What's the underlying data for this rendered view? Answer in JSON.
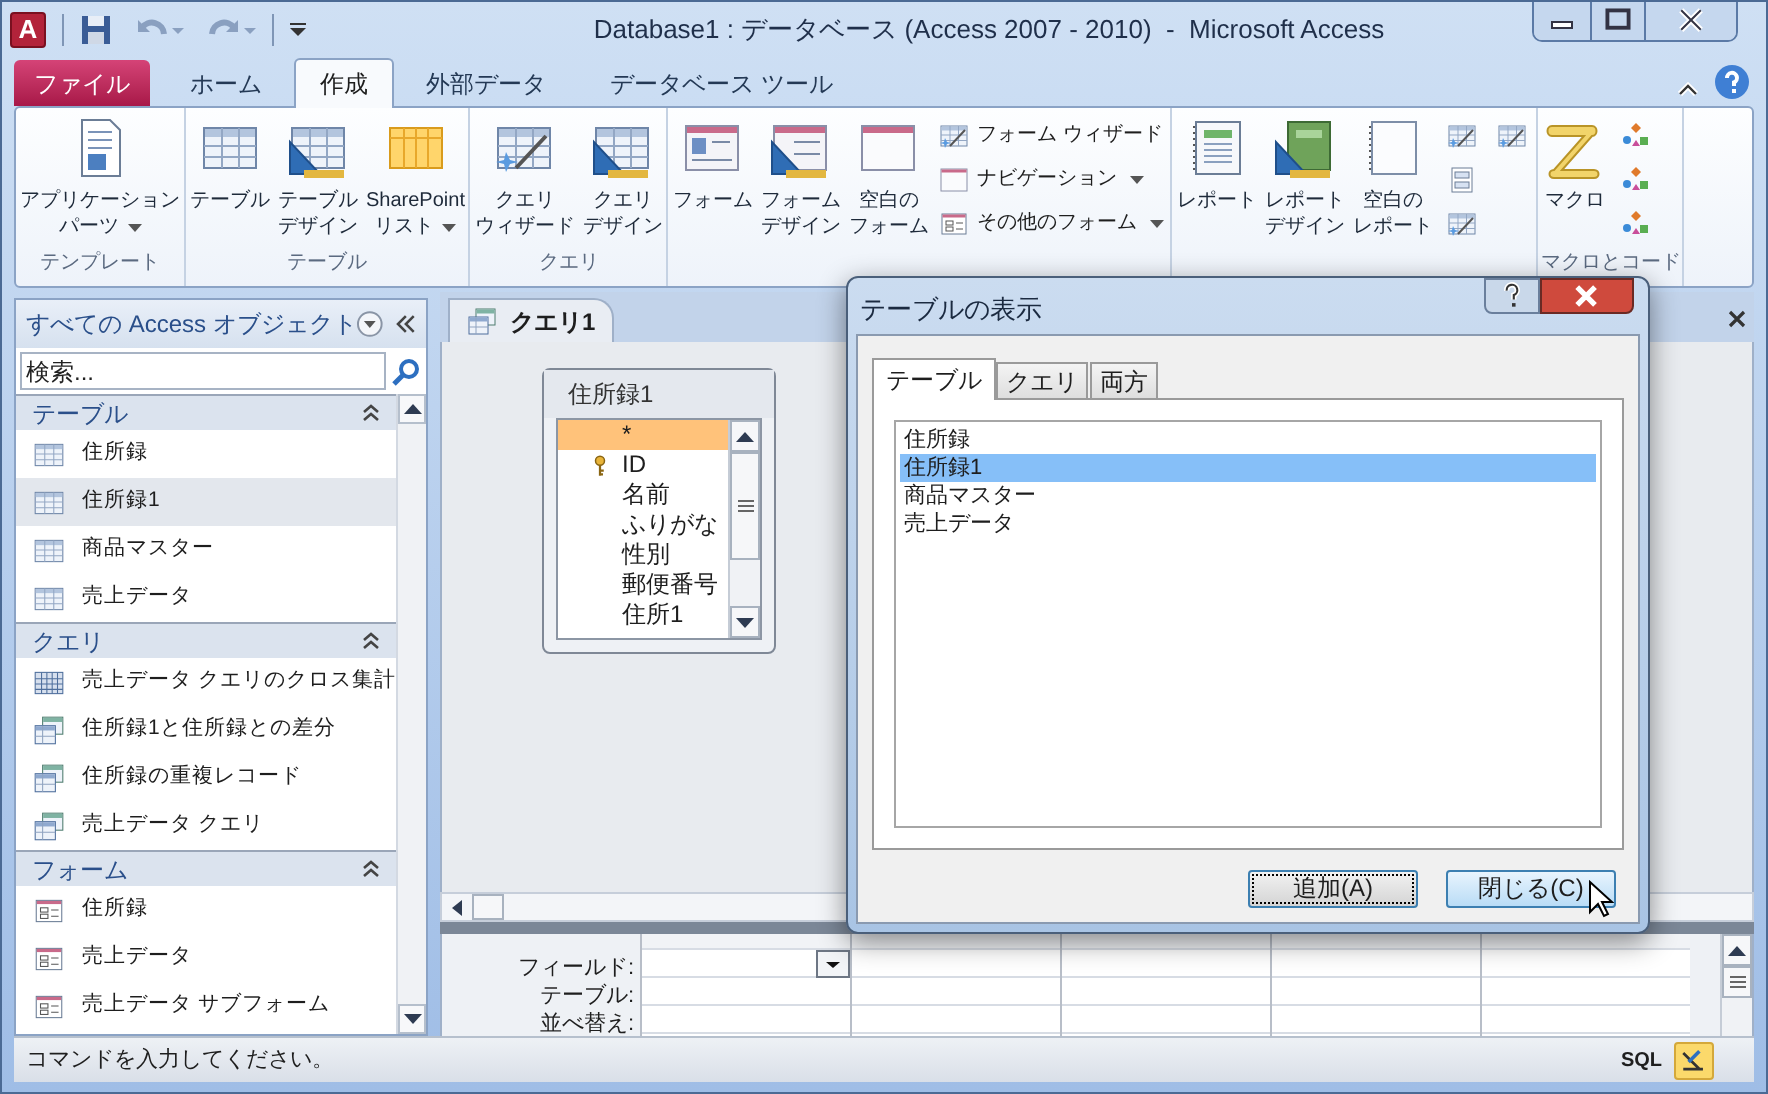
{
  "title_bar": {
    "logo_letter": "A",
    "title": "Database1 : データベース (Access 2007 - 2010)  -  Microsoft Access"
  },
  "ribbon": {
    "tabs": [
      {
        "label": "ファイル",
        "kind": "file",
        "selected": false
      },
      {
        "label": "ホーム",
        "kind": "tab",
        "selected": false
      },
      {
        "label": "作成",
        "kind": "tab",
        "selected": true
      },
      {
        "label": "外部データ",
        "kind": "tab",
        "selected": false
      },
      {
        "label": "データベース ツール",
        "kind": "tab",
        "selected": false
      }
    ],
    "groups": [
      {
        "label": "テンプレート",
        "items": [
          {
            "kind": "large",
            "lines": [
              "アプリケーション",
              "パーツ"
            ],
            "dropdown": true
          }
        ]
      },
      {
        "label": "テーブル",
        "items": [
          {
            "kind": "large",
            "lines": [
              "テーブル"
            ],
            "dropdown": false
          },
          {
            "kind": "large",
            "lines": [
              "テーブル",
              "デザイン"
            ],
            "dropdown": false
          },
          {
            "kind": "large",
            "lines": [
              "SharePoint",
              "リスト"
            ],
            "dropdown": true
          }
        ]
      },
      {
        "label": "クエリ",
        "items": [
          {
            "kind": "large",
            "lines": [
              "クエリ",
              "ウィザード"
            ],
            "dropdown": false
          },
          {
            "kind": "large",
            "lines": [
              "クエリ",
              "デザイン"
            ],
            "dropdown": false
          }
        ]
      },
      {
        "items": [
          {
            "kind": "large",
            "lines": [
              "フォーム"
            ],
            "dropdown": false
          },
          {
            "kind": "large",
            "lines": [
              "フォーム",
              "デザイン"
            ],
            "dropdown": false
          },
          {
            "kind": "large",
            "lines": [
              "空白の",
              "フォーム"
            ],
            "dropdown": false
          },
          {
            "kind": "small",
            "label": "フォーム ウィザード",
            "dropdown": false
          },
          {
            "kind": "small",
            "label": "ナビゲーション",
            "dropdown": true
          },
          {
            "kind": "small",
            "label": "その他のフォーム",
            "dropdown": true
          }
        ]
      },
      {
        "items": [
          {
            "kind": "large",
            "lines": [
              "レポート"
            ],
            "dropdown": false
          },
          {
            "kind": "large",
            "lines": [
              "レポート",
              "デザイン"
            ],
            "dropdown": false
          },
          {
            "kind": "large",
            "lines": [
              "空白の",
              "レポート"
            ],
            "dropdown": false
          },
          {
            "kind": "icon"
          },
          {
            "kind": "icon"
          },
          {
            "kind": "icon"
          },
          {
            "kind": "icon"
          }
        ]
      },
      {
        "label": "マクロとコード",
        "items": [
          {
            "kind": "large",
            "lines": [
              "マクロ"
            ],
            "dropdown": false
          },
          {
            "kind": "icon"
          },
          {
            "kind": "icon"
          },
          {
            "kind": "icon"
          }
        ]
      }
    ]
  },
  "nav_pane": {
    "title": "すべての Access オブジェクト",
    "search": {
      "placeholder": "検索..."
    },
    "sections": [
      {
        "label": "テーブル",
        "expanded": true,
        "kind": "table",
        "items": [
          {
            "label": "住所録",
            "selected": false
          },
          {
            "label": "住所録1",
            "selected": true
          },
          {
            "label": "商品マスター",
            "selected": false
          },
          {
            "label": "売上データ",
            "selected": false
          }
        ]
      },
      {
        "label": "クエリ",
        "expanded": true,
        "kind": "query",
        "items": [
          {
            "label": "売上データ クエリのクロス集計",
            "selected": false
          },
          {
            "label": "住所録1と住所録との差分",
            "selected": false
          },
          {
            "label": "住所録の重複レコード",
            "selected": false
          },
          {
            "label": "売上データ クエリ",
            "selected": false
          }
        ]
      },
      {
        "label": "フォーム",
        "expanded": true,
        "kind": "form",
        "items": [
          {
            "label": "住所録",
            "selected": false
          },
          {
            "label": "売上データ",
            "selected": false
          },
          {
            "label": "売上データ サブフォーム",
            "selected": false
          }
        ]
      }
    ]
  },
  "document_tab": {
    "label": "クエリ1"
  },
  "query_table": {
    "title": "住所録1",
    "fields": [
      {
        "label": "*",
        "selected": true,
        "primary_key": false
      },
      {
        "label": "ID",
        "selected": false,
        "primary_key": true
      },
      {
        "label": "名前",
        "selected": false,
        "primary_key": false
      },
      {
        "label": "ふりがな",
        "selected": false,
        "primary_key": false
      },
      {
        "label": "性別",
        "selected": false,
        "primary_key": false
      },
      {
        "label": "郵便番号",
        "selected": false,
        "primary_key": false
      },
      {
        "label": "住所1",
        "selected": false,
        "primary_key": false
      }
    ]
  },
  "design_grid": {
    "row_labels": [
      "フィールド:",
      "テーブル:",
      "並べ替え:"
    ]
  },
  "dialog": {
    "title": "テーブルの表示",
    "tabs": [
      {
        "label": "テーブル",
        "selected": true
      },
      {
        "label": "クエリ",
        "selected": false
      },
      {
        "label": "両方",
        "selected": false
      }
    ],
    "items": [
      {
        "label": "住所録",
        "selected": false
      },
      {
        "label": "住所録1",
        "selected": true
      },
      {
        "label": "商品マスター",
        "selected": false
      },
      {
        "label": "売上データ",
        "selected": false
      }
    ],
    "buttons": [
      {
        "label": "追加(A)",
        "focused": true,
        "hovered": false
      },
      {
        "label": "閉じる(C)",
        "focused": false,
        "hovered": true
      }
    ]
  },
  "status_bar": {
    "message": "コマンドを入力してください。",
    "sql_label": "SQL"
  }
}
